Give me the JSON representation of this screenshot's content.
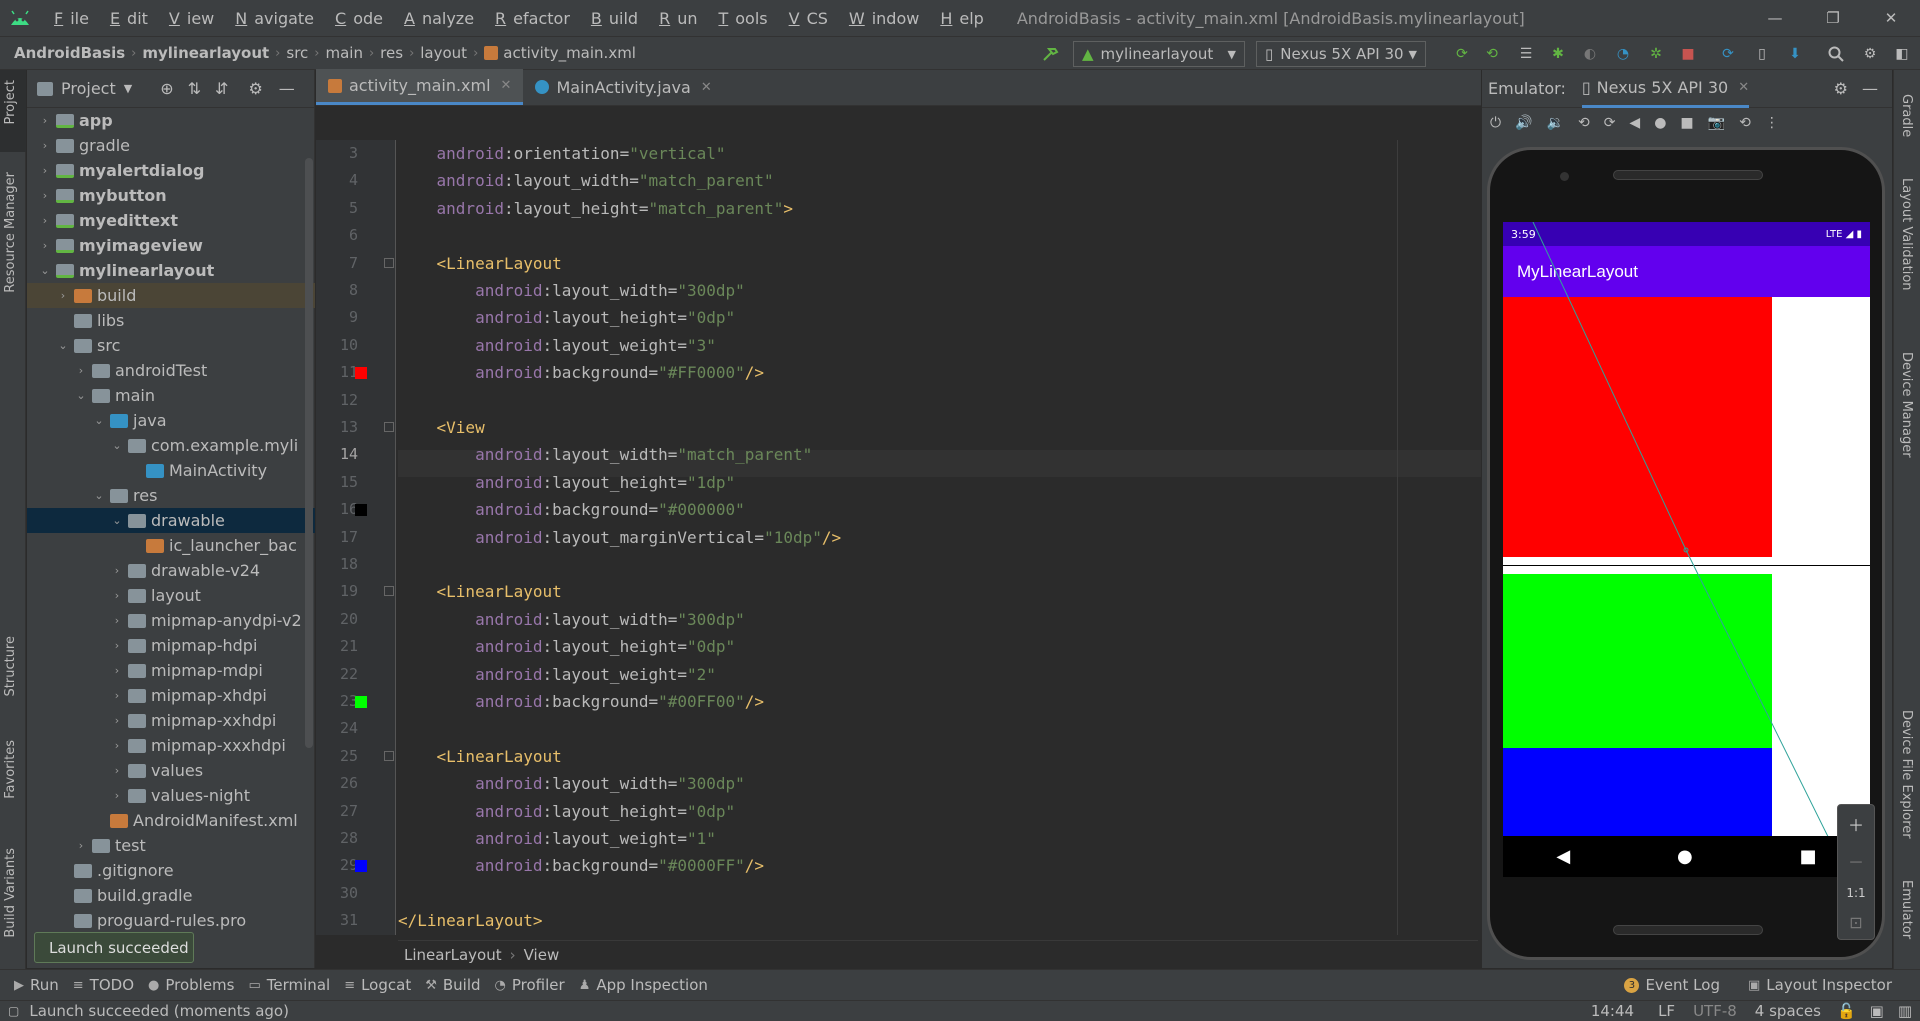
{
  "window": {
    "title": "AndroidBasis - activity_main.xml [AndroidBasis.mylinearlayout]"
  },
  "menu": [
    "File",
    "Edit",
    "View",
    "Navigate",
    "Code",
    "Analyze",
    "Refactor",
    "Build",
    "Run",
    "Tools",
    "VCS",
    "Window",
    "Help"
  ],
  "nav": {
    "crumbs": [
      "AndroidBasis",
      "mylinearlayout",
      "src",
      "main",
      "res",
      "layout",
      "activity_main.xml"
    ],
    "run_config": "mylinearlayout",
    "device": "Nexus 5X API 30"
  },
  "sidebar_left": [
    "Project",
    "Resource Manager",
    "Structure",
    "Favorites",
    "Build Variants"
  ],
  "sidebar_right": [
    "Gradle",
    "Layout Validation",
    "Device Manager",
    "Device File Explorer",
    "Emulator"
  ],
  "project": {
    "title": "Project",
    "tree": [
      {
        "label": "app",
        "indent": 0,
        "arrow": "›",
        "icon": "mod",
        "bold": true
      },
      {
        "label": "gradle",
        "indent": 0,
        "arrow": "›",
        "icon": "fold",
        "bold": false
      },
      {
        "label": "myalertdialog",
        "indent": 0,
        "arrow": "›",
        "icon": "mod",
        "bold": true
      },
      {
        "label": "mybutton",
        "indent": 0,
        "arrow": "›",
        "icon": "mod",
        "bold": true
      },
      {
        "label": "myedittext",
        "indent": 0,
        "arrow": "›",
        "icon": "mod",
        "bold": true
      },
      {
        "label": "myimageview",
        "indent": 0,
        "arrow": "›",
        "icon": "mod",
        "bold": true
      },
      {
        "label": "mylinearlayout",
        "indent": 0,
        "arrow": "⌄",
        "icon": "mod",
        "bold": true
      },
      {
        "label": "build",
        "indent": 1,
        "arrow": "›",
        "icon": "bfold",
        "bold": false,
        "state": "bsel"
      },
      {
        "label": "libs",
        "indent": 1,
        "arrow": "",
        "icon": "fold",
        "bold": false
      },
      {
        "label": "src",
        "indent": 1,
        "arrow": "⌄",
        "icon": "fold",
        "bold": false
      },
      {
        "label": "androidTest",
        "indent": 2,
        "arrow": "›",
        "icon": "fold",
        "bold": false
      },
      {
        "label": "main",
        "indent": 2,
        "arrow": "⌄",
        "icon": "fold",
        "bold": false
      },
      {
        "label": "java",
        "indent": 3,
        "arrow": "⌄",
        "icon": "jfold",
        "bold": false
      },
      {
        "label": "com.example.myli",
        "indent": 4,
        "arrow": "⌄",
        "icon": "fold",
        "bold": false
      },
      {
        "label": "MainActivity",
        "indent": 5,
        "arrow": "",
        "icon": "jfold",
        "bold": false
      },
      {
        "label": "res",
        "indent": 3,
        "arrow": "⌄",
        "icon": "fold",
        "bold": false
      },
      {
        "label": "drawable",
        "indent": 4,
        "arrow": "⌄",
        "icon": "fold",
        "bold": false,
        "state": "sel"
      },
      {
        "label": "ic_launcher_bac",
        "indent": 5,
        "arrow": "",
        "icon": "bfold",
        "bold": false
      },
      {
        "label": "drawable-v24",
        "indent": 4,
        "arrow": "›",
        "icon": "fold",
        "bold": false
      },
      {
        "label": "layout",
        "indent": 4,
        "arrow": "›",
        "icon": "fold",
        "bold": false
      },
      {
        "label": "mipmap-anydpi-v2",
        "indent": 4,
        "arrow": "›",
        "icon": "fold",
        "bold": false
      },
      {
        "label": "mipmap-hdpi",
        "indent": 4,
        "arrow": "›",
        "icon": "fold",
        "bold": false
      },
      {
        "label": "mipmap-mdpi",
        "indent": 4,
        "arrow": "›",
        "icon": "fold",
        "bold": false
      },
      {
        "label": "mipmap-xhdpi",
        "indent": 4,
        "arrow": "›",
        "icon": "fold",
        "bold": false
      },
      {
        "label": "mipmap-xxhdpi",
        "indent": 4,
        "arrow": "›",
        "icon": "fold",
        "bold": false
      },
      {
        "label": "mipmap-xxxhdpi",
        "indent": 4,
        "arrow": "›",
        "icon": "fold",
        "bold": false
      },
      {
        "label": "values",
        "indent": 4,
        "arrow": "›",
        "icon": "fold",
        "bold": false
      },
      {
        "label": "values-night",
        "indent": 4,
        "arrow": "›",
        "icon": "fold",
        "bold": false
      },
      {
        "label": "AndroidManifest.xml",
        "indent": 3,
        "arrow": "",
        "icon": "bfold",
        "bold": false
      },
      {
        "label": "test",
        "indent": 2,
        "arrow": "›",
        "icon": "fold",
        "bold": false
      },
      {
        "label": ".gitignore",
        "indent": 1,
        "arrow": "",
        "icon": "fold",
        "bold": false
      },
      {
        "label": "build.gradle",
        "indent": 1,
        "arrow": "",
        "icon": "fold",
        "bold": false
      },
      {
        "label": "proguard-rules.pro",
        "indent": 1,
        "arrow": "",
        "icon": "fold",
        "bold": false
      }
    ]
  },
  "editor": {
    "tabs": [
      {
        "label": "activity_main.xml",
        "active": true
      },
      {
        "label": "MainActivity.java",
        "active": false
      }
    ],
    "breadcrumb": [
      "LinearLayout",
      "View"
    ],
    "lines": [
      {
        "n": "3",
        "segs": [
          [
            "",
            "    "
          ],
          [
            "ns",
            "android"
          ],
          [
            "at",
            ":orientation="
          ],
          [
            "v",
            "\"vertical\""
          ]
        ]
      },
      {
        "n": "4",
        "segs": [
          [
            "",
            "    "
          ],
          [
            "ns",
            "android"
          ],
          [
            "at",
            ":layout_width="
          ],
          [
            "v",
            "\"match_parent\""
          ]
        ]
      },
      {
        "n": "5",
        "segs": [
          [
            "",
            "    "
          ],
          [
            "ns",
            "android"
          ],
          [
            "at",
            ":layout_height="
          ],
          [
            "v",
            "\"match_parent\""
          ],
          [
            "tag",
            ">"
          ]
        ]
      },
      {
        "n": "6",
        "segs": []
      },
      {
        "n": "7",
        "segs": [
          [
            "",
            "    "
          ],
          [
            "tag",
            "<LinearLayout"
          ]
        ]
      },
      {
        "n": "8",
        "segs": [
          [
            "",
            "        "
          ],
          [
            "ns",
            "android"
          ],
          [
            "at",
            ":layout_width="
          ],
          [
            "v",
            "\"300dp\""
          ]
        ]
      },
      {
        "n": "9",
        "segs": [
          [
            "",
            "        "
          ],
          [
            "ns",
            "android"
          ],
          [
            "at",
            ":layout_height="
          ],
          [
            "v",
            "\"0dp\""
          ]
        ]
      },
      {
        "n": "10",
        "segs": [
          [
            "",
            "        "
          ],
          [
            "ns",
            "android"
          ],
          [
            "at",
            ":layout_weight="
          ],
          [
            "v",
            "\"3\""
          ]
        ]
      },
      {
        "n": "11",
        "segs": [
          [
            "",
            "        "
          ],
          [
            "ns",
            "android"
          ],
          [
            "at",
            ":background="
          ],
          [
            "v",
            "\"#FF0000\""
          ],
          [
            "tag",
            "/>"
          ]
        ],
        "swatch": "#FF0000"
      },
      {
        "n": "12",
        "segs": []
      },
      {
        "n": "13",
        "segs": [
          [
            "",
            "    "
          ],
          [
            "tag",
            "<View"
          ]
        ]
      },
      {
        "n": "14",
        "segs": [
          [
            "",
            "        "
          ],
          [
            "ns",
            "android"
          ],
          [
            "at",
            ":layout_width="
          ],
          [
            "v",
            "\"match_parent\""
          ]
        ]
      },
      {
        "n": "15",
        "segs": [
          [
            "",
            "        "
          ],
          [
            "ns",
            "android"
          ],
          [
            "at",
            ":layout_height="
          ],
          [
            "v",
            "\"1dp\""
          ]
        ]
      },
      {
        "n": "16",
        "segs": [
          [
            "",
            "        "
          ],
          [
            "ns",
            "android"
          ],
          [
            "at",
            ":background="
          ],
          [
            "v",
            "\"#000000\""
          ]
        ],
        "swatch": "#000000"
      },
      {
        "n": "17",
        "segs": [
          [
            "",
            "        "
          ],
          [
            "ns",
            "android"
          ],
          [
            "at",
            ":layout_marginVertical="
          ],
          [
            "v",
            "\"10dp\""
          ],
          [
            "tag",
            "/>"
          ]
        ]
      },
      {
        "n": "18",
        "segs": []
      },
      {
        "n": "19",
        "segs": [
          [
            "",
            "    "
          ],
          [
            "tag",
            "<LinearLayout"
          ]
        ]
      },
      {
        "n": "20",
        "segs": [
          [
            "",
            "        "
          ],
          [
            "ns",
            "android"
          ],
          [
            "at",
            ":layout_width="
          ],
          [
            "v",
            "\"300dp\""
          ]
        ]
      },
      {
        "n": "21",
        "segs": [
          [
            "",
            "        "
          ],
          [
            "ns",
            "android"
          ],
          [
            "at",
            ":layout_height="
          ],
          [
            "v",
            "\"0dp\""
          ]
        ]
      },
      {
        "n": "22",
        "segs": [
          [
            "",
            "        "
          ],
          [
            "ns",
            "android"
          ],
          [
            "at",
            ":layout_weight="
          ],
          [
            "v",
            "\"2\""
          ]
        ]
      },
      {
        "n": "23",
        "segs": [
          [
            "",
            "        "
          ],
          [
            "ns",
            "android"
          ],
          [
            "at",
            ":background="
          ],
          [
            "v",
            "\"#00FF00\""
          ],
          [
            "tag",
            "/>"
          ]
        ],
        "swatch": "#00FF00"
      },
      {
        "n": "24",
        "segs": []
      },
      {
        "n": "25",
        "segs": [
          [
            "",
            "    "
          ],
          [
            "tag",
            "<LinearLayout"
          ]
        ]
      },
      {
        "n": "26",
        "segs": [
          [
            "",
            "        "
          ],
          [
            "ns",
            "android"
          ],
          [
            "at",
            ":layout_width="
          ],
          [
            "v",
            "\"300dp\""
          ]
        ]
      },
      {
        "n": "27",
        "segs": [
          [
            "",
            "        "
          ],
          [
            "ns",
            "android"
          ],
          [
            "at",
            ":layout_height="
          ],
          [
            "v",
            "\"0dp\""
          ]
        ]
      },
      {
        "n": "28",
        "segs": [
          [
            "",
            "        "
          ],
          [
            "ns",
            "android"
          ],
          [
            "at",
            ":layout_weight="
          ],
          [
            "v",
            "\"1\""
          ]
        ]
      },
      {
        "n": "29",
        "segs": [
          [
            "",
            "        "
          ],
          [
            "ns",
            "android"
          ],
          [
            "at",
            ":background="
          ],
          [
            "v",
            "\"#0000FF\""
          ],
          [
            "tag",
            "/>"
          ]
        ],
        "swatch": "#0000FF"
      },
      {
        "n": "30",
        "segs": []
      },
      {
        "n": "31",
        "segs": [
          [
            "tag",
            "</LinearLayout>"
          ]
        ]
      }
    ]
  },
  "emulator": {
    "label": "Emulator:",
    "tab": "Nexus 5X API 30",
    "time": "3:59",
    "network": "LTE",
    "app_title": "MyLinearLayout",
    "zoom_label": "1:1"
  },
  "toast": "Launch succeeded",
  "toolwindows": [
    {
      "label": "Run",
      "icon": "▶"
    },
    {
      "label": "TODO",
      "icon": "≡"
    },
    {
      "label": "Problems",
      "icon": "●"
    },
    {
      "label": "Terminal",
      "icon": "▭"
    },
    {
      "label": "Logcat",
      "icon": "≡"
    },
    {
      "label": "Build",
      "icon": "⚒"
    },
    {
      "label": "Profiler",
      "icon": "◔"
    },
    {
      "label": "App Inspection",
      "icon": "♟"
    }
  ],
  "toolwindows_right": [
    {
      "label": "Event Log",
      "badge": "3"
    },
    {
      "label": "Layout Inspector",
      "icon": "▣"
    }
  ],
  "status": {
    "message": "Launch succeeded (moments ago)",
    "position": "14:44",
    "eol": "LF",
    "encoding": "UTF-8",
    "indent": "4 spaces"
  }
}
